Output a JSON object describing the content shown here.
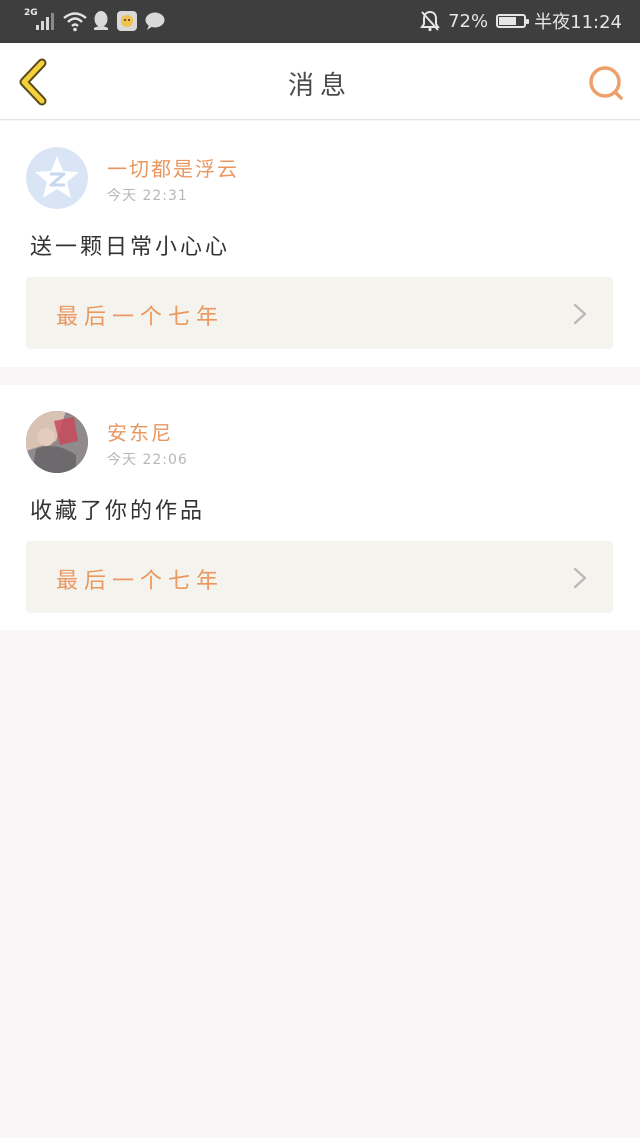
{
  "status_bar": {
    "network": "2G",
    "battery_percent": "72%",
    "battery_level": 0.72,
    "time": "半夜11:24",
    "icons": [
      "signal-icon",
      "wifi-icon",
      "qq-icon",
      "app-icon",
      "chat-icon",
      "bell-muted-icon",
      "battery-icon"
    ]
  },
  "header": {
    "title": "消息",
    "back_icon": "chevron-left-icon",
    "search_icon": "search-icon",
    "accent_color": "#e9975f"
  },
  "messages": [
    {
      "username": "一切都是浮云",
      "timestamp": "今天 22:31",
      "text": "送一颗日常小心心",
      "work_title": "最后一个七年",
      "avatar": "qzone-avatar-icon"
    },
    {
      "username": "安东尼",
      "timestamp": "今天 22:06",
      "text": "收藏了你的作品",
      "work_title": "最后一个七年",
      "avatar": "user-photo-avatar"
    }
  ]
}
